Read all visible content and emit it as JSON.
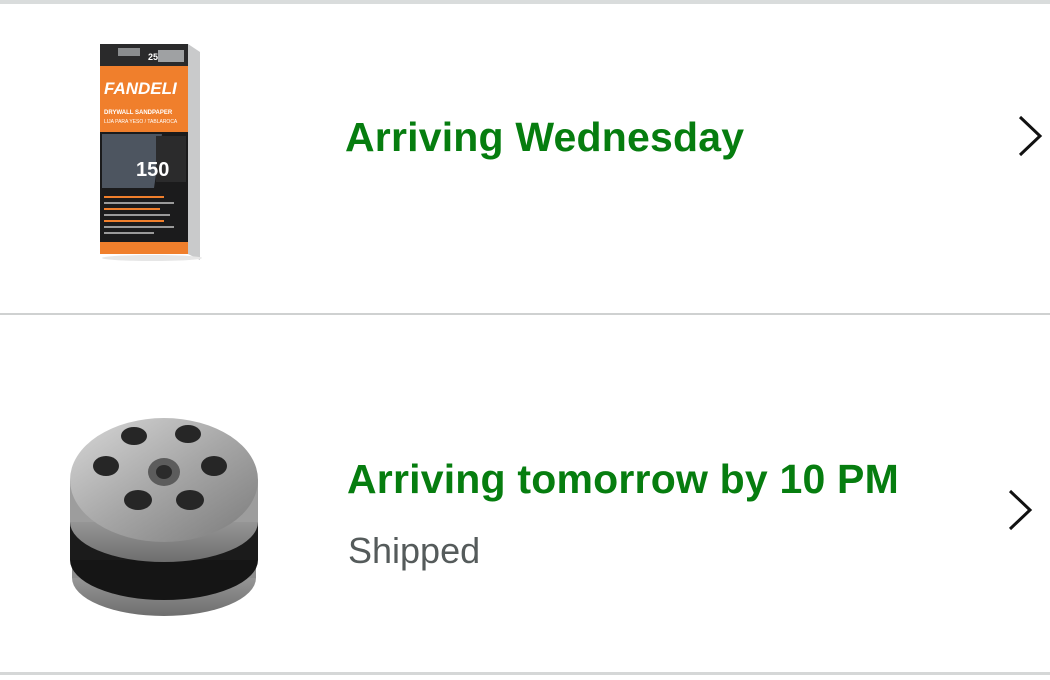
{
  "orders": [
    {
      "status": "Arriving Wednesday",
      "substatus": "",
      "product_image": "sandpaper-box-image",
      "package_text": {
        "brand": "FANDELI",
        "count": "25",
        "product": "DRYWALL SANDPAPER",
        "product_es": "LIJA PARA YESO / TABLAROCA",
        "grit": "150"
      }
    },
    {
      "status": "Arriving tomorrow by 10 PM",
      "substatus": "Shipped",
      "product_image": "clutch-bell-image"
    }
  ],
  "colors": {
    "status_green": "#067d0f",
    "substatus_gray": "#555b5b",
    "divider": "#cfd1d1",
    "package_orange": "#f07f2c"
  },
  "icons": {
    "row_chevron": "chevron-right-icon"
  }
}
